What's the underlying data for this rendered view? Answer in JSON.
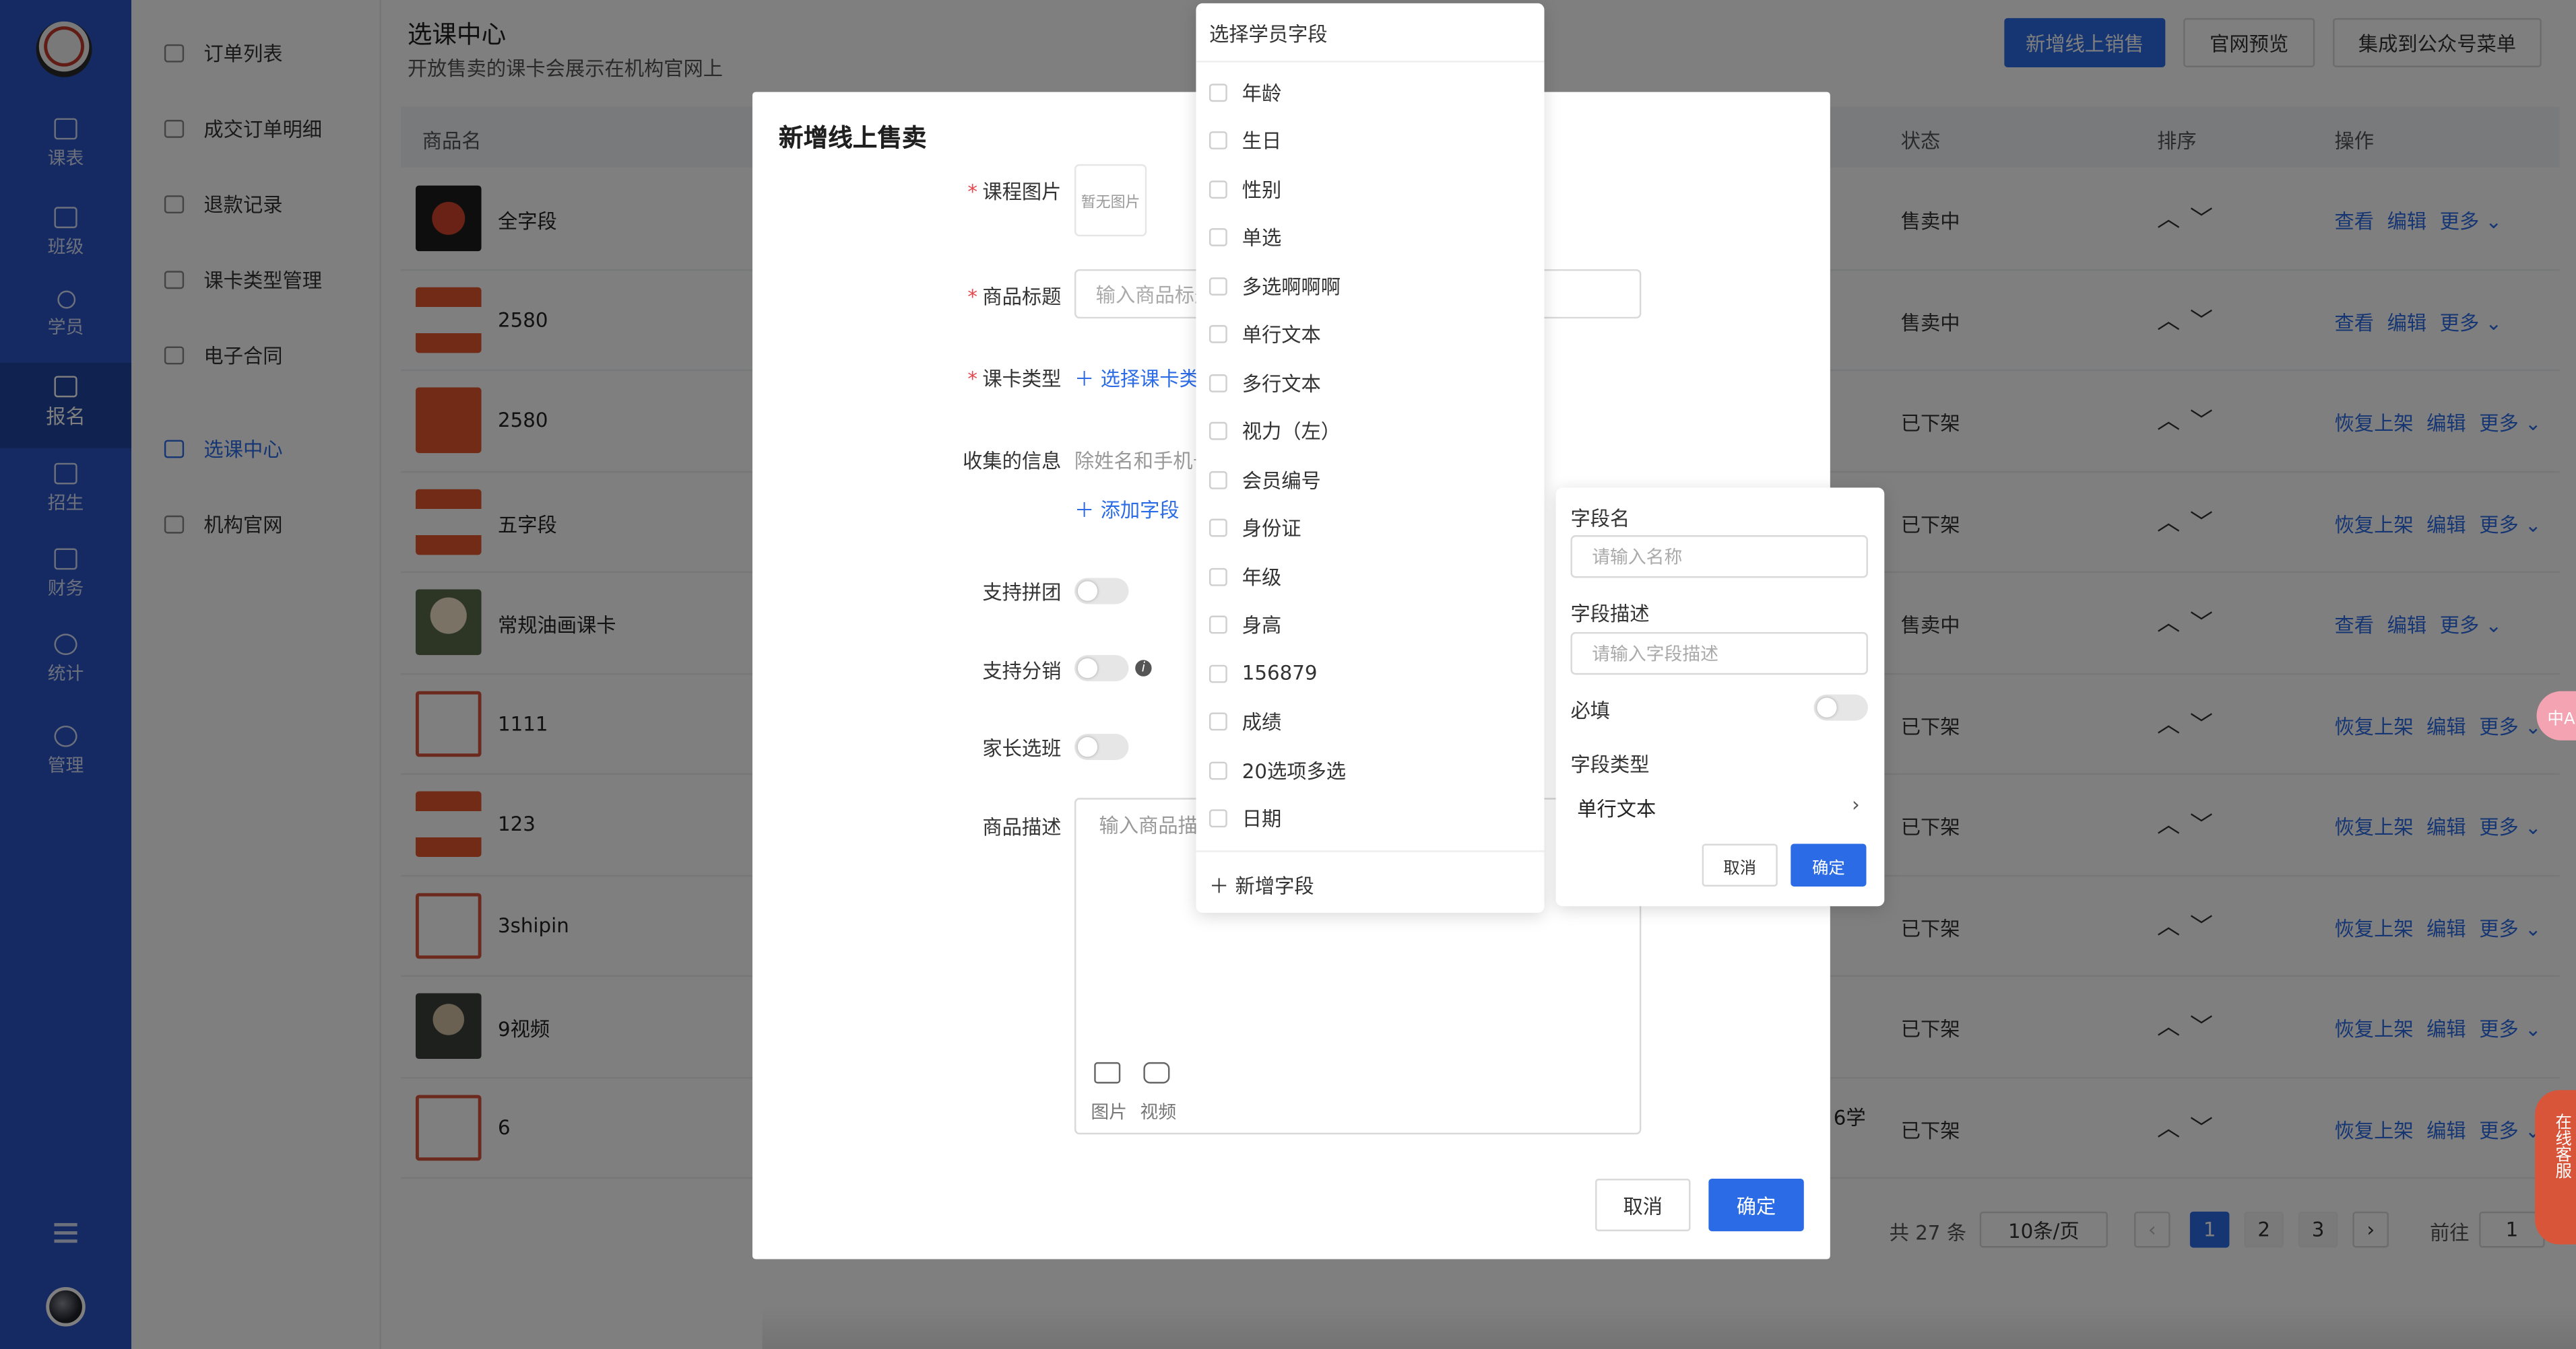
{
  "nav": {
    "items": [
      {
        "label": "课表",
        "icon": "calendar-icon"
      },
      {
        "label": "班级",
        "icon": "classroom-icon"
      },
      {
        "label": "学员",
        "icon": "user-icon"
      },
      {
        "label": "报名",
        "icon": "cart-icon",
        "active": true
      },
      {
        "label": "招生",
        "icon": "megaphone-icon"
      },
      {
        "label": "财务",
        "icon": "wallet-icon"
      },
      {
        "label": "统计",
        "icon": "chart-pie-icon"
      },
      {
        "label": "管理",
        "icon": "gear-icon"
      }
    ]
  },
  "subnav": {
    "items": [
      {
        "label": "订单列表",
        "icon": "cart-icon"
      },
      {
        "label": "成交订单明细",
        "icon": "bag-icon"
      },
      {
        "label": "退款记录",
        "icon": "refund-icon"
      },
      {
        "label": "课卡类型管理",
        "icon": "card-icon"
      },
      {
        "label": "电子合同",
        "icon": "contract-icon"
      },
      {
        "label": "选课中心",
        "icon": "gift-icon",
        "active": true
      },
      {
        "label": "机构官网",
        "icon": "building-icon"
      }
    ]
  },
  "header": {
    "title": "选课中心",
    "subtitle": "开放售卖的课卡会展示在机构官网上",
    "buttons": {
      "new_sale": "新增线上销售",
      "preview": "官网预览",
      "integrate": "集成到公众号菜单"
    }
  },
  "table": {
    "columns": {
      "name": "商品名",
      "status": "状态",
      "sort": "排序",
      "ops": "操作"
    },
    "rows": [
      {
        "name": "全字段",
        "status": "售卖中",
        "ops": [
          "查看",
          "编辑",
          "更多"
        ]
      },
      {
        "name": "2580",
        "status": "售卖中",
        "ops": [
          "查看",
          "编辑",
          "更多"
        ]
      },
      {
        "name": "2580",
        "status": "已下架",
        "ops": [
          "恢复上架",
          "编辑",
          "更多"
        ]
      },
      {
        "name": "五字段",
        "status": "已下架",
        "ops": [
          "恢复上架",
          "编辑",
          "更多"
        ]
      },
      {
        "name": "常规油画课卡",
        "status": "售卖中",
        "ops": [
          "查看",
          "编辑",
          "更多"
        ]
      },
      {
        "name": "1111",
        "status": "已下架",
        "ops": [
          "恢复上架",
          "编辑",
          "更多"
        ]
      },
      {
        "name": "123",
        "status": "已下架",
        "ops": [
          "恢复上架",
          "编辑",
          "更多"
        ]
      },
      {
        "name": "3shipin",
        "status": "已下架",
        "ops": [
          "恢复上架",
          "编辑",
          "更多"
        ]
      },
      {
        "name": "9视频",
        "status": "已下架",
        "ops": [
          "恢复上架",
          "编辑",
          "更多"
        ]
      },
      {
        "name": "6",
        "status": "已下架",
        "ops": [
          "恢复上架",
          "编辑",
          "更多"
        ]
      }
    ],
    "partial_text": "6学"
  },
  "pager": {
    "total": "共 27 条",
    "page_size": "10条/页",
    "pages": [
      "1",
      "2",
      "3"
    ],
    "current": "1",
    "goto_label": "前往",
    "goto_value": "1"
  },
  "modal": {
    "title": "新增线上售卖",
    "fields": {
      "image_label": "课程图片",
      "image_placeholder": "暂无图片",
      "title_label": "商品标题",
      "title_placeholder": "输入商品标题",
      "card_type_label": "课卡类型",
      "card_type_link": "选择课卡类型",
      "collect_label": "收集的信息",
      "collect_hint": "除姓名和手机号外",
      "add_field_link": "添加字段",
      "group_label": "支持拼团",
      "dist_label": "支持分销",
      "parent_label": "家长选班",
      "desc_label": "商品描述",
      "desc_placeholder": "输入商品描述",
      "editor_image": "图片",
      "editor_video": "视频"
    },
    "cancel": "取消",
    "confirm": "确定"
  },
  "dropdown": {
    "title": "选择学员字段",
    "options": [
      "年龄",
      "生日",
      "性别",
      "单选",
      "多选啊啊啊",
      "单行文本",
      "多行文本",
      "视力（左）",
      "会员编号",
      "身份证",
      "年级",
      "身高",
      "156879",
      "成绩",
      "20选项多选",
      "日期"
    ],
    "add_label": "新增字段"
  },
  "field_panel": {
    "name_label": "字段名",
    "name_placeholder": "请输入名称",
    "desc_label": "字段描述",
    "desc_placeholder": "请输入字段描述",
    "required_label": "必填",
    "type_label": "字段类型",
    "type_value": "单行文本",
    "cancel": "取消",
    "confirm": "确定"
  },
  "float": {
    "service": "在线客服",
    "lang": "中A"
  },
  "colors": {
    "brand": "#2b54c6",
    "accent": "#2b6be6",
    "required": "#e5484d",
    "service": "#d8553a"
  }
}
